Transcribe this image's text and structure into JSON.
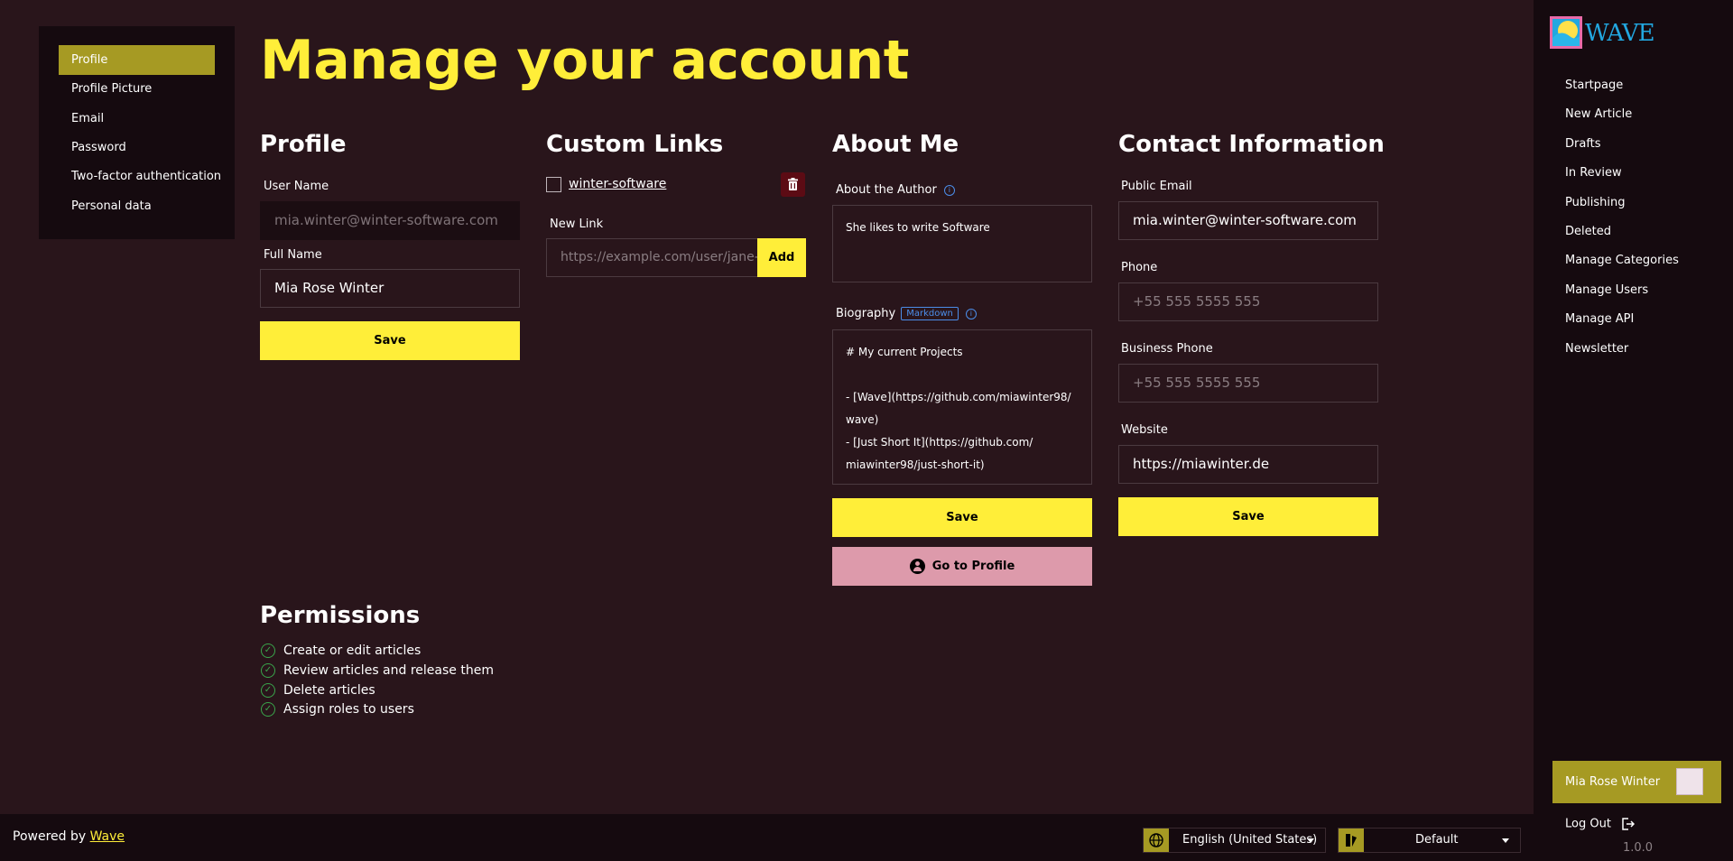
{
  "page": {
    "title": "Manage your account"
  },
  "settings_nav": {
    "items": [
      {
        "label": "Profile",
        "active": true
      },
      {
        "label": "Profile Picture",
        "active": false
      },
      {
        "label": "Email",
        "active": false
      },
      {
        "label": "Password",
        "active": false
      },
      {
        "label": "Two-factor authentication",
        "active": false
      },
      {
        "label": "Personal data",
        "active": false
      }
    ]
  },
  "profile": {
    "heading": "Profile",
    "username_label": "User Name",
    "username_value": "mia.winter@winter-software.com",
    "fullname_label": "Full Name",
    "fullname_value": "Mia Rose Winter",
    "save_label": "Save"
  },
  "custom_links": {
    "heading": "Custom Links",
    "links": [
      {
        "label": "winter-software"
      }
    ],
    "new_link_label": "New Link",
    "new_link_placeholder": "https://example.com/user/jane-",
    "add_label": "Add"
  },
  "about_me": {
    "heading": "About Me",
    "about_label": "About the Author",
    "about_value": "She likes to write Software",
    "bio_label": "Biography",
    "bio_badge": "Markdown",
    "bio_lines": [
      "# My current Projects",
      "",
      "- [Wave](https://github.com/miawinter98/",
      "wave)",
      "- [Just Short It](https://github.com/",
      "miawinter98/just-short-it)"
    ],
    "save_label": "Save",
    "go_profile_label": "Go to Profile"
  },
  "contact": {
    "heading": "Contact Information",
    "public_email_label": "Public Email",
    "public_email_value": "mia.winter@winter-software.com",
    "phone_label": "Phone",
    "phone_placeholder": "+55 555 5555 555",
    "business_phone_label": "Business Phone",
    "business_phone_placeholder": "+55 555 5555 555",
    "website_label": "Website",
    "website_value": "https://miawinter.de",
    "save_label": "Save"
  },
  "permissions": {
    "heading": "Permissions",
    "items": [
      "Create or edit articles",
      "Review articles and release them",
      "Delete articles",
      "Assign roles to users"
    ]
  },
  "sidebar": {
    "logo_text": "WAVE",
    "items": [
      "Startpage",
      "New Article",
      "Drafts",
      "In Review",
      "Publishing",
      "Deleted",
      "Manage Categories",
      "Manage Users",
      "Manage API",
      "Newsletter"
    ],
    "user_name": "Mia Rose Winter",
    "logout_label": "Log Out",
    "version": "1.0.0"
  },
  "footer": {
    "powered_prefix": "Powered by",
    "powered_link": "Wave",
    "language": "English (United States)",
    "theme": "Default"
  },
  "colors": {
    "accent": "#ffee39",
    "active_nav": "#a69a23",
    "background": "#29151b",
    "panel": "#150a0f",
    "profile_button": "#dd9aab",
    "delete_button": "#5c0b14"
  }
}
